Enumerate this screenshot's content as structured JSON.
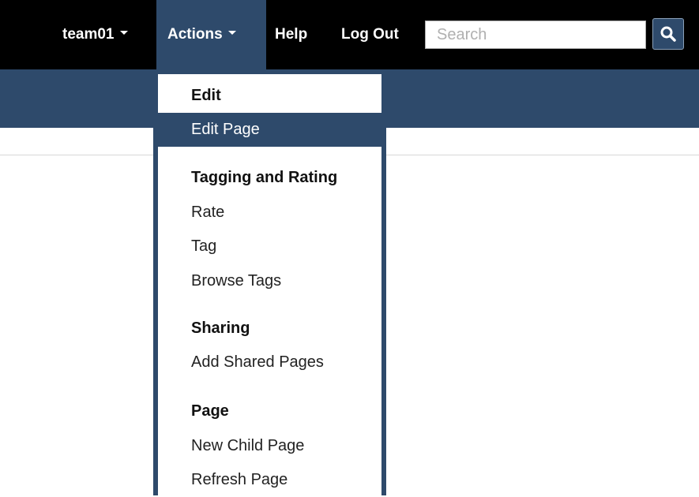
{
  "topbar": {
    "user_menu": "team01",
    "actions_menu": "Actions",
    "help": "Help",
    "logout": "Log Out",
    "search": {
      "placeholder": "Search",
      "value": ""
    }
  },
  "colors": {
    "topbar": "#000000",
    "accent": "#2e4a6b",
    "text": "#222222"
  },
  "dropdown": {
    "groups": [
      {
        "heading": "Edit",
        "items": [
          "Edit Page"
        ],
        "active_index": 0
      },
      {
        "heading": "Tagging and Rating",
        "items": [
          "Rate",
          "Tag",
          "Browse Tags"
        ]
      },
      {
        "heading": "Sharing",
        "items": [
          "Add Shared Pages"
        ]
      },
      {
        "heading": "Page",
        "items": [
          "New Child Page",
          "Refresh Page"
        ]
      }
    ]
  },
  "icons": {
    "search_button": "search-icon",
    "user_menu_caret": "caret-down-icon",
    "actions_menu_caret": "caret-down-icon"
  }
}
